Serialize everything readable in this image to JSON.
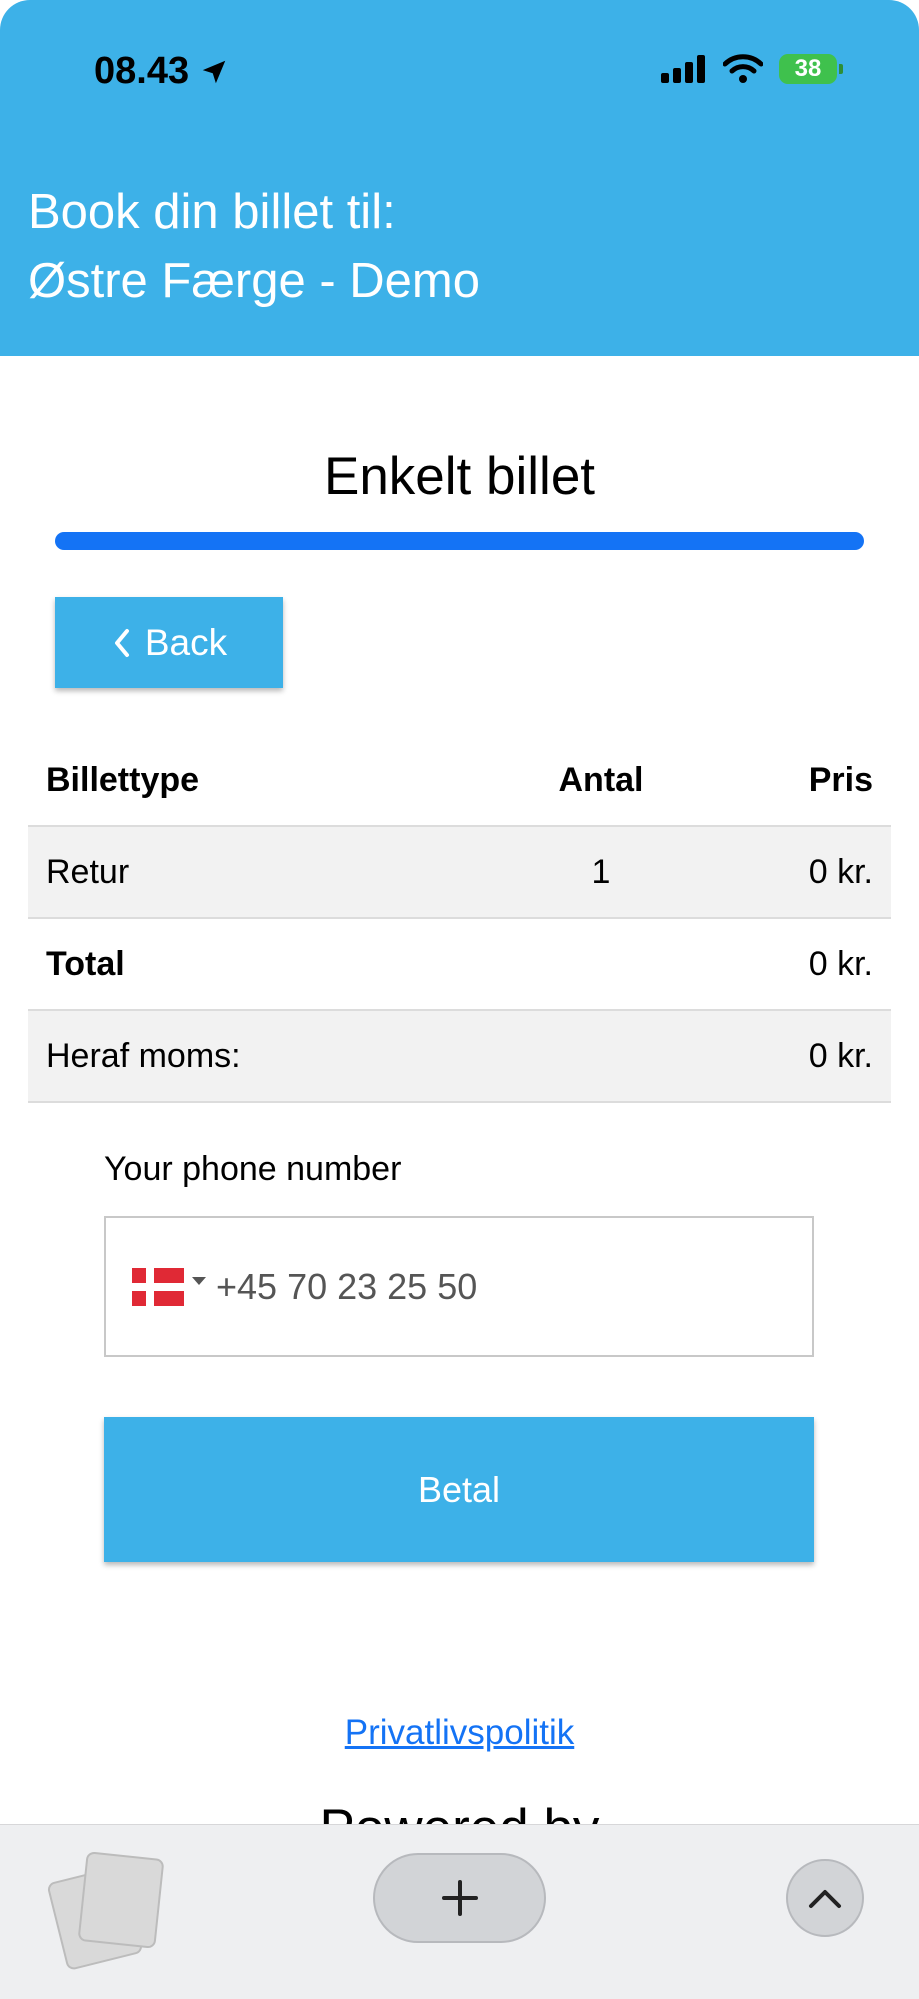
{
  "status_bar": {
    "time": "08.43",
    "battery": "38"
  },
  "header": {
    "line1": "Book din billet til:",
    "line2": "Østre Færge - Demo"
  },
  "page": {
    "title": "Enkelt billet",
    "progress_percent": 100,
    "back_label": "Back"
  },
  "table": {
    "headers": [
      "Billettype",
      "Antal",
      "Pris"
    ],
    "rows": [
      {
        "type": "Retur",
        "quantity": "1",
        "price": "0 kr."
      }
    ],
    "total_label": "Total",
    "total_value": "0 kr.",
    "vat_label": "Heraf moms:",
    "vat_value": "0 kr."
  },
  "phone": {
    "label": "Your phone number",
    "value": "+45 70 23 25 50",
    "country": "DK"
  },
  "pay": {
    "label": "Betal"
  },
  "footer": {
    "privacy": "Privatlivspolitik",
    "powered": "Powered by"
  },
  "colors": {
    "header_bg": "#3db1e8",
    "progress": "#1473f5",
    "button_bg": "#3db1e8"
  }
}
